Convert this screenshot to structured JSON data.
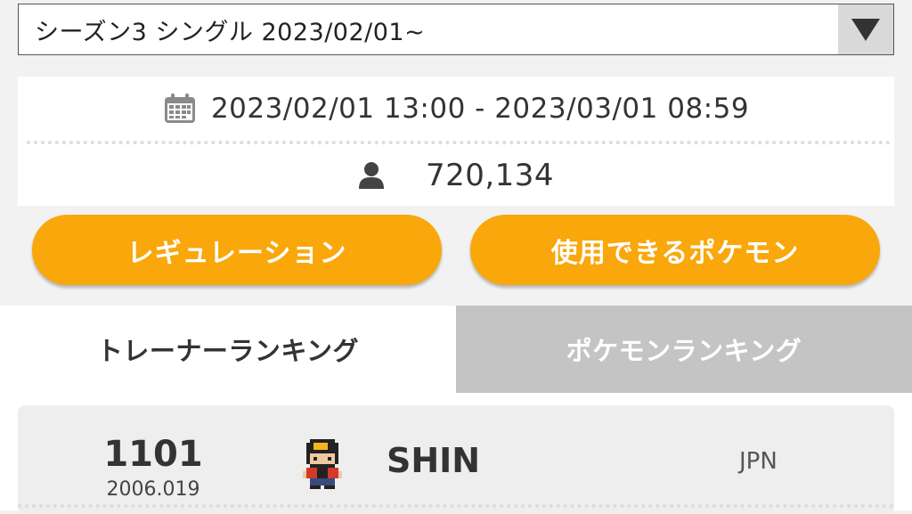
{
  "season_select": {
    "label": "シーズン3 シングル 2023/02/01~",
    "arrow_icon": "triangle-down-icon"
  },
  "season_info": {
    "period_icon": "calendar-icon",
    "period": "2023/02/01 13:00 - 2023/03/01 08:59",
    "players_icon": "person-icon",
    "players": "720,134"
  },
  "buttons": {
    "regulation": "レギュレーション",
    "usable_pokemon": "使用できるポケモン"
  },
  "tabs": {
    "trainer_ranking": "トレーナーランキング",
    "pokemon_ranking": "ポケモンランキング",
    "active": "trainer_ranking"
  },
  "rankings": [
    {
      "rank": "1101",
      "rating": "2006.019",
      "name": "SHIN",
      "country": "JPN"
    }
  ],
  "colors": {
    "accent": "#f9a70b",
    "inactive_tab": "#c4c4c4",
    "background": "#f2f2f2"
  }
}
